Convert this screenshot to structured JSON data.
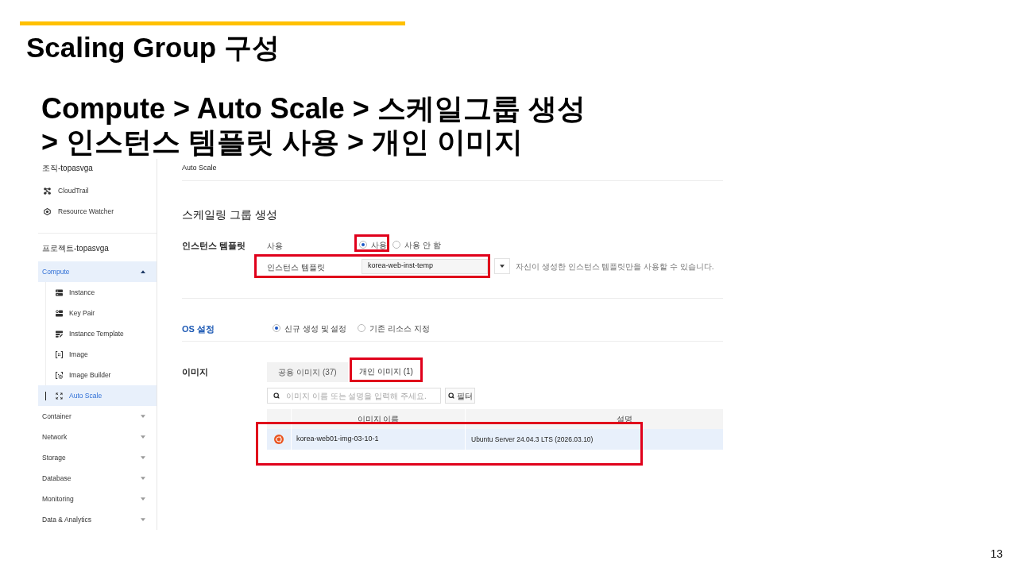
{
  "slide": {
    "title": "Scaling Group 구성",
    "path_lines": [
      "Compute > Auto Scale > 스케일그룹 생성",
      "> 인스턴스 템플릿 사용 > 개인 이미지"
    ],
    "page_number": "13"
  },
  "sidebar": {
    "org_title": "조직-topasvga",
    "org_links": [
      "CloudTrail",
      "Resource Watcher"
    ],
    "project_title": "프로젝트-topasvga",
    "menu": [
      {
        "label": "Compute",
        "selected": true,
        "expanded": true,
        "children": [
          {
            "label": "Instance",
            "selected": false
          },
          {
            "label": "Key Pair",
            "selected": false
          },
          {
            "label": "Instance Template",
            "selected": false
          },
          {
            "label": "Image",
            "selected": false
          },
          {
            "label": "Image Builder",
            "selected": false
          },
          {
            "label": "Auto Scale",
            "selected": true
          }
        ]
      },
      {
        "label": "Container",
        "selected": false,
        "expanded": false
      },
      {
        "label": "Network",
        "selected": false,
        "expanded": false
      },
      {
        "label": "Storage",
        "selected": false,
        "expanded": false
      },
      {
        "label": "Database",
        "selected": false,
        "expanded": false
      },
      {
        "label": "Monitoring",
        "selected": false,
        "expanded": false
      },
      {
        "label": "Data & Analytics",
        "selected": false,
        "expanded": false
      }
    ]
  },
  "main": {
    "breadcrumb": "Auto Scale",
    "title": "스케일링 그룹 생성",
    "instance_template": {
      "label": "인스턴스 템플릿",
      "use_label": "사용",
      "use_options": [
        {
          "label": "사용",
          "selected": true,
          "highlighted": true
        },
        {
          "label": "사용 안 함",
          "selected": false,
          "highlighted": false
        }
      ],
      "template_label": "인스턴스 템플릿",
      "template_select": {
        "value": "korea-web-inst-temp",
        "highlighted": true
      },
      "hint": "자신이 생성한 인스턴스 템플릿만을 사용할 수 있습니다."
    },
    "os_settings": {
      "label": "OS 설정",
      "options": [
        {
          "label": "신규 생성 및 설정",
          "selected": true
        },
        {
          "label": "기존 리소스 지정",
          "selected": false
        }
      ]
    },
    "image": {
      "label": "이미지",
      "tabs": [
        {
          "label": "공용 이미지 (37)",
          "selected": false,
          "highlighted": false
        },
        {
          "label": "개인 이미지 (1)",
          "selected": true,
          "highlighted": true
        }
      ],
      "search": {
        "placeholder": "이미지 이름 또는 설명을 입력해 주세요."
      },
      "filter_button": "필터",
      "table": {
        "columns": [
          "이미지 이름",
          "설명"
        ],
        "rows": [
          {
            "name": "korea-web01-img-03-10-1",
            "description": "Ubuntu Server 24.04.3 LTS (2026.03.10)",
            "selected": true,
            "highlighted": true
          }
        ]
      }
    }
  }
}
